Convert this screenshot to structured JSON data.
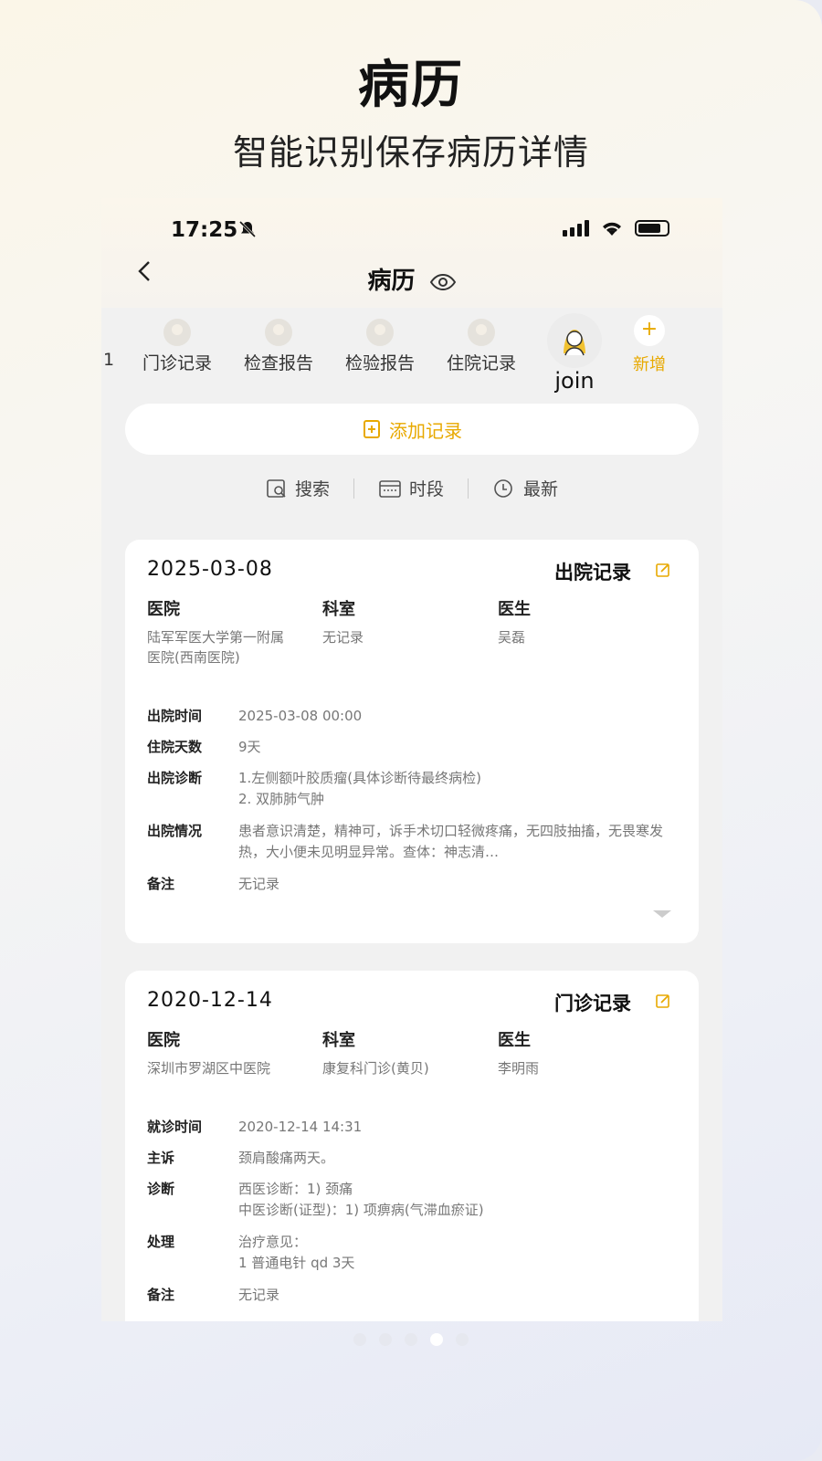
{
  "promo": {
    "title": "病历",
    "subtitle": "智能识别保存病历详情"
  },
  "status": {
    "time": "17:25"
  },
  "nav": {
    "title": "病历"
  },
  "tabs": [
    {
      "label": "门诊记录"
    },
    {
      "label": "检查报告"
    },
    {
      "label": "检验报告"
    },
    {
      "label": "住院记录"
    }
  ],
  "tab_partial": "1",
  "tab_join": "join",
  "tab_add": {
    "plus": "+",
    "label": "新增"
  },
  "add_record": "添加记录",
  "tools": {
    "search": "搜索",
    "period": "时段",
    "latest": "最新"
  },
  "card1": {
    "date": "2025-03-08",
    "type": "出院记录",
    "hospital_label": "医院",
    "hospital": "陆军军医大学第一附属医院(西南医院)",
    "dept_label": "科室",
    "dept": "无记录",
    "doctor_label": "医生",
    "doctor": "吴磊",
    "rows": [
      {
        "k": "出院时间",
        "v": "2025-03-08 00:00"
      },
      {
        "k": "住院天数",
        "v": "9天"
      },
      {
        "k": "出院诊断",
        "v": "1.左侧额叶胶质瘤(具体诊断待最终病检)\n2. 双肺肺气肿"
      },
      {
        "k": "出院情况",
        "v": "患者意识清楚，精神可，诉手术切口轻微疼痛，无四肢抽搐，无畏寒发热，大小便未见明显异常。查体：神志清…"
      },
      {
        "k": "备注",
        "v": "无记录"
      }
    ]
  },
  "card2": {
    "date": "2020-12-14",
    "type": "门诊记录",
    "hospital_label": "医院",
    "hospital": "深圳市罗湖区中医院",
    "dept_label": "科室",
    "dept": "康复科门诊(黄贝)",
    "doctor_label": "医生",
    "doctor": "李明雨",
    "rows": [
      {
        "k": "就诊时间",
        "v": "2020-12-14 14:31"
      },
      {
        "k": "主诉",
        "v": "颈肩酸痛两天。"
      },
      {
        "k": "诊断",
        "v": "西医诊断：1) 颈痛\n中医诊断(证型)：1) 项痹病(气滞血瘀证)"
      },
      {
        "k": "处理",
        "v": "治疗意见：\n1 普通电针 qd 3天"
      },
      {
        "k": "备注",
        "v": "无记录"
      }
    ]
  },
  "colors": {
    "accent": "#e8a900"
  }
}
